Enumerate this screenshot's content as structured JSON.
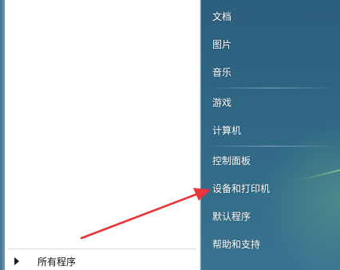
{
  "left_pane": {
    "all_programs_label": "所有程序"
  },
  "right_pane": {
    "items": [
      {
        "label": "文档"
      },
      {
        "label": "图片"
      },
      {
        "label": "音乐"
      },
      {
        "label": "游戏"
      },
      {
        "label": "计算机"
      },
      {
        "label": "控制面板"
      },
      {
        "label": "设备和打印机"
      },
      {
        "label": "默认程序"
      },
      {
        "label": "帮助和支持"
      }
    ]
  },
  "annotation": {
    "arrow_color": "#e8363a",
    "points_to": "设备和打印机"
  }
}
